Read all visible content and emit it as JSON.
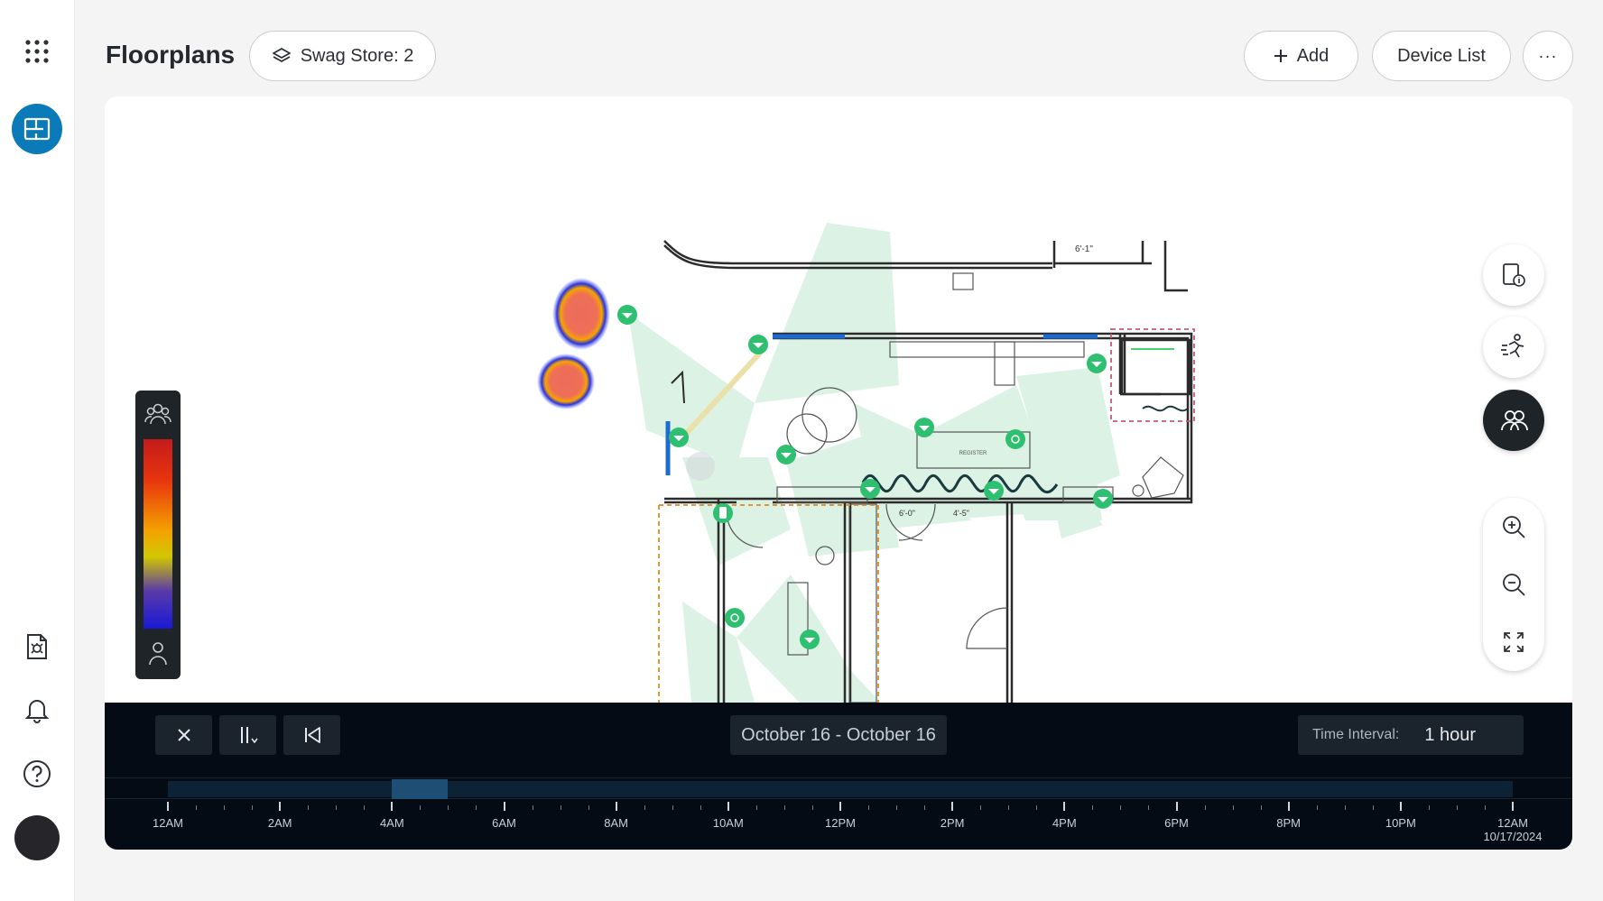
{
  "app": {
    "title": "Floorplans"
  },
  "header": {
    "store_label": "Swag Store: 2",
    "add_label": "Add",
    "device_list_label": "Device List",
    "more_label": "···"
  },
  "sidebar": {
    "icons": [
      "apps-grid-icon",
      "floorplan-icon",
      "report-icon",
      "bell-icon",
      "help-icon",
      "avatar"
    ]
  },
  "floorplan": {
    "labels": {
      "register": "REGISTER",
      "dim1": "6'-1\"",
      "dim2": "6'-0\"",
      "dim3": "4'-5\""
    }
  },
  "legend": {
    "gradient_colors": [
      "#c41b1b",
      "#e8350e",
      "#f4a100",
      "#d2c700",
      "#5a3aa7",
      "#1a1ad6"
    ]
  },
  "timeline": {
    "date_range": "October 16 - October 16",
    "interval_label": "Time Interval:",
    "interval_value": "1 hour",
    "ticks": [
      "12AM",
      "2AM",
      "4AM",
      "6AM",
      "8AM",
      "10AM",
      "12PM",
      "2PM",
      "4PM",
      "6PM",
      "8PM",
      "10PM",
      "12AM"
    ],
    "end_date": "10/17/2024"
  },
  "colors": {
    "accent": "#0a7bb8",
    "camera": "#2fbf71",
    "timeline_bg": "#040b14",
    "selected": "#1f4e75"
  }
}
